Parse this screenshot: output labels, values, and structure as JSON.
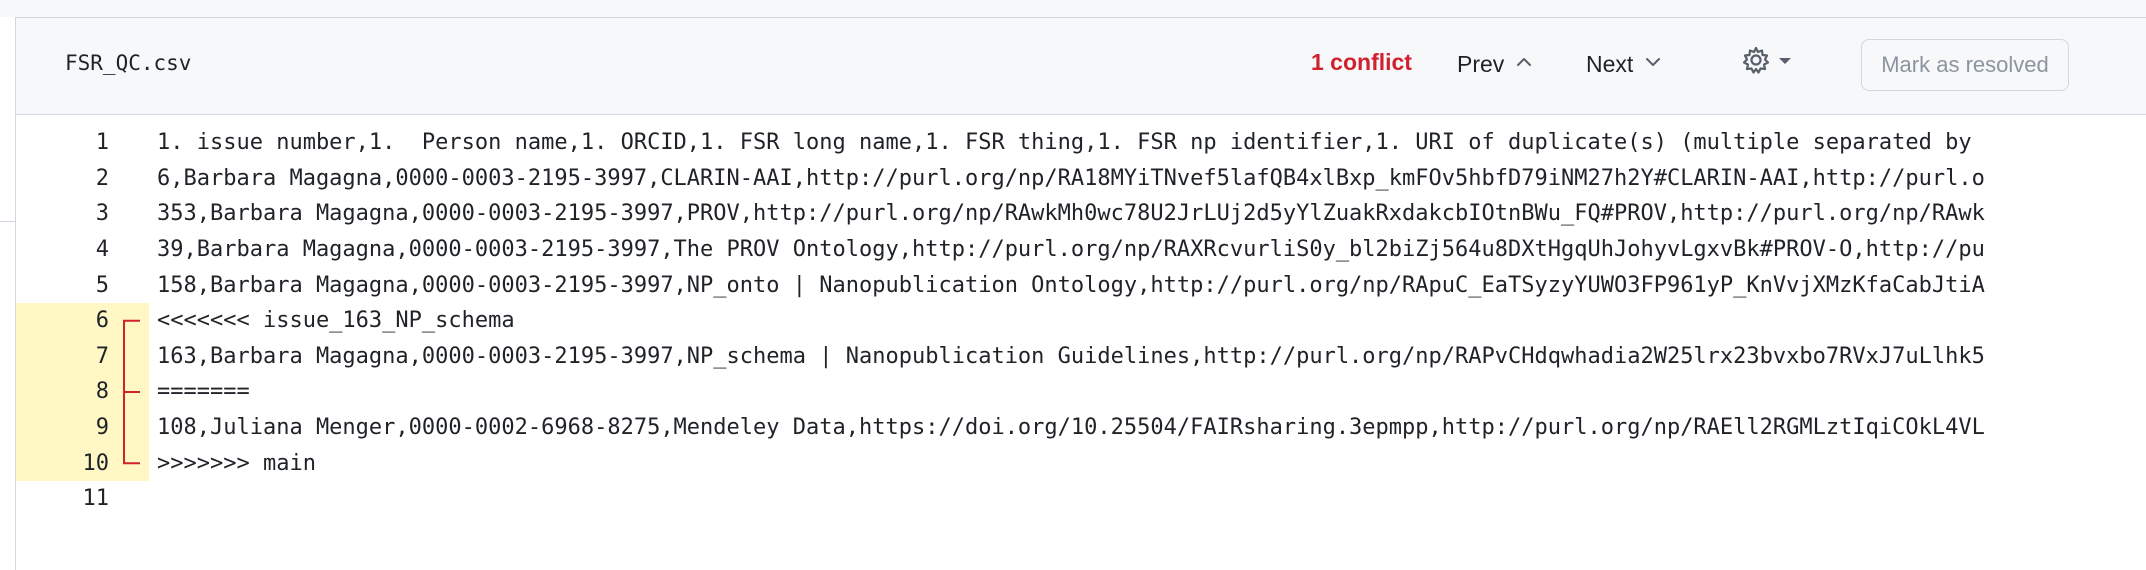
{
  "file": {
    "name": "FSR_QC.csv"
  },
  "toolbar": {
    "conflict_count": "1 conflict",
    "prev_label": "Prev",
    "next_label": "Next",
    "settings_icon": "gear-icon",
    "mark_resolved_label": "Mark as resolved"
  },
  "colors": {
    "conflict_text": "#cf222e",
    "conflict_highlight": "#fff8c5",
    "conflict_bracket": "#cf222e",
    "header_bg": "#f6f8fa"
  },
  "lines": [
    {
      "n": "1",
      "text": "1. issue number,1.  Person name,1. ORCID,1. FSR long name,1. FSR thing,1. FSR np identifier,1. URI of duplicate(s) (multiple separated by",
      "conflict": false
    },
    {
      "n": "2",
      "text": "6,Barbara Magagna,0000-0003-2195-3997,CLARIN-AAI,http://purl.org/np/RA18MYiTNvef5lafQB4xlBxp_kmFOv5hbfD79iNM27h2Y#CLARIN-AAI,http://purl.o",
      "conflict": false
    },
    {
      "n": "3",
      "text": "353,Barbara Magagna,0000-0003-2195-3997,PROV,http://purl.org/np/RAwkMh0wc78U2JrLUj2d5yYlZuakRxdakcbIOtnBWu_FQ#PROV,http://purl.org/np/RAwk",
      "conflict": false
    },
    {
      "n": "4",
      "text": "39,Barbara Magagna,0000-0003-2195-3997,The PROV Ontology,http://purl.org/np/RAXRcvurliS0y_bl2biZj564u8DXtHgqUhJohyvLgxvBk#PROV-O,http://pu",
      "conflict": false
    },
    {
      "n": "5",
      "text": "158,Barbara Magagna,0000-0003-2195-3997,NP_onto | Nanopublication Ontology,http://purl.org/np/RApuC_EaTSyzyYUWO3FP961yP_KnVvjXMzKfaCabJtiA",
      "conflict": false
    },
    {
      "n": "6",
      "text": "<<<<<<< issue_163_NP_schema",
      "conflict": true
    },
    {
      "n": "7",
      "text": "163,Barbara Magagna,0000-0003-2195-3997,NP_schema | Nanopublication Guidelines,http://purl.org/np/RAPvCHdqwhadia2W25lrx23bvxbo7RVxJ7uLlhk5",
      "conflict": true
    },
    {
      "n": "8",
      "text": "=======",
      "conflict": true
    },
    {
      "n": "9",
      "text": "108,Juliana Menger,0000-0002-6968-8275,Mendeley Data,https://doi.org/10.25504/FAIRsharing.3epmpp,http://purl.org/np/RAEll2RGMLztIqiCOkL4VL",
      "conflict": true
    },
    {
      "n": "10",
      "text": ">>>>>>> main",
      "conflict": true
    },
    {
      "n": "11",
      "text": "",
      "conflict": false
    }
  ]
}
